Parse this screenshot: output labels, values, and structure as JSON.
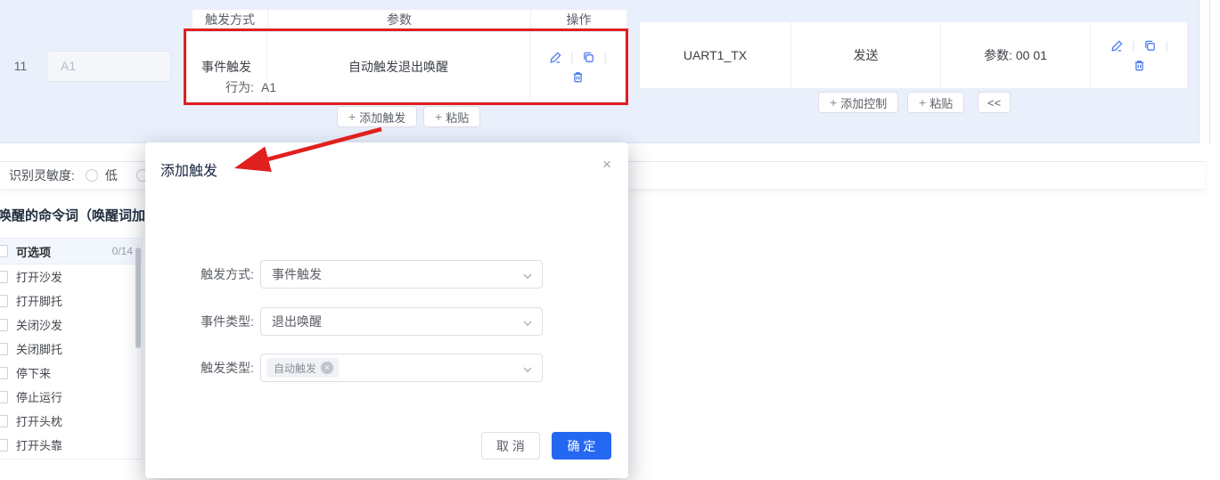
{
  "colors": {
    "accent_blue": "#2468f2",
    "icon_blue": "#4e7cf0",
    "highlight_red": "#e0201f",
    "band_blue": "#e9effb"
  },
  "top": {
    "row_index": "11",
    "behavior_input_value": "A1",
    "trigger_table": {
      "headers": [
        "触发方式",
        "参数",
        "操作"
      ],
      "row": {
        "trigger_type": "事件触发",
        "param": "自动触发退出唤醒"
      },
      "add_trigger_button": "添加触发",
      "paste_button": "粘贴"
    },
    "control_table": {
      "row": {
        "channel": "UART1_TX",
        "action": "发送",
        "param": "参数: 00 01"
      },
      "add_control_button": "添加控制",
      "paste_button": "粘贴",
      "collapse_button": "<<"
    }
  },
  "sensitivity": {
    "label": "识别灵敏度:",
    "option_low": "低"
  },
  "wake_section": {
    "title": "唤醒的命令词（唤醒词加上"
  },
  "options_panel": {
    "header": "可选项",
    "count": "0/14",
    "items": [
      "打开沙发",
      "打开脚托",
      "关闭沙发",
      "关闭脚托",
      "停下来",
      "停止运行",
      "打开头枕",
      "打开头靠"
    ]
  },
  "modal": {
    "title": "添加触发",
    "close": "×",
    "behavior_label": "行为:",
    "behavior_value": "A1",
    "trigger_method_label": "触发方式:",
    "trigger_method_value": "事件触发",
    "event_type_label": "事件类型:",
    "event_type_value": "退出唤醒",
    "trigger_type_label": "触发类型:",
    "trigger_type_tag": "自动触发",
    "cancel_button": "取 消",
    "confirm_button": "确 定"
  }
}
